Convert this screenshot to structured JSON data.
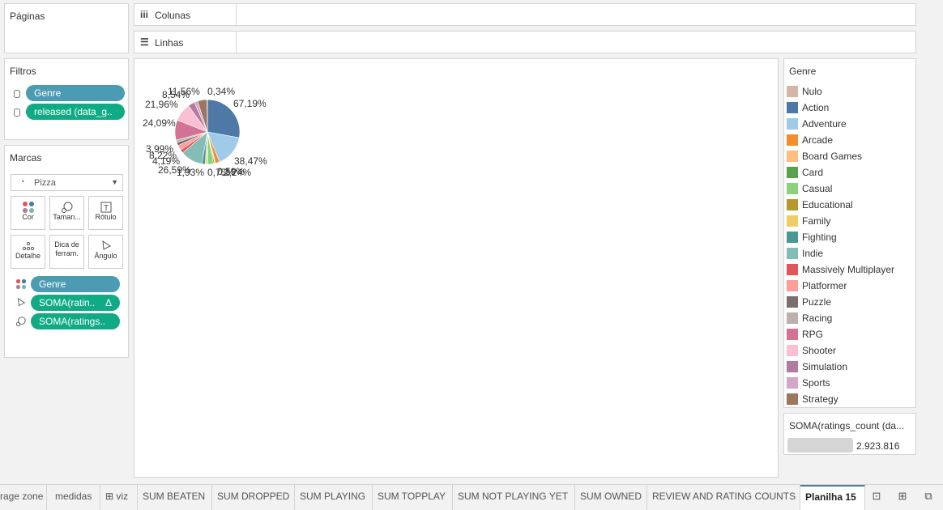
{
  "pages_panel": {
    "title": "Páginas"
  },
  "filters_panel": {
    "title": "Filtros",
    "pills": [
      "Genre",
      "released (data_g.."
    ]
  },
  "marks_panel": {
    "title": "Marcas",
    "mark_type": "Pizza",
    "buttons": [
      {
        "label": "Cor",
        "icon": "color-icon"
      },
      {
        "label": "Taman...",
        "icon": "size-icon"
      },
      {
        "label": "Rótulo",
        "icon": "label-icon"
      },
      {
        "label": "Detalhe",
        "icon": "detail-icon"
      },
      {
        "label": "Dica de ferram.",
        "icon": "tooltip-icon"
      },
      {
        "label": "Ângulo",
        "icon": "angle-icon"
      }
    ],
    "encodings": [
      {
        "label": "Genre",
        "icon": "color-icon",
        "color": "blue"
      },
      {
        "label": "SOMA(ratin..",
        "icon": "angle-icon",
        "color": "green",
        "delta": "Δ"
      },
      {
        "label": "SOMA(ratings..",
        "icon": "size-icon",
        "color": "green"
      }
    ]
  },
  "shelves": {
    "columns": {
      "label": "Colunas",
      "icon": "iii"
    },
    "rows": {
      "label": "Linhas",
      "icon": "☰"
    }
  },
  "chart_data": {
    "type": "pie",
    "slices": [
      {
        "genre": "Action",
        "value": 67.19,
        "color": "#4e79a7"
      },
      {
        "genre": "Adventure",
        "value": 38.47,
        "color": "#a0cbe8"
      },
      {
        "genre": "Arcade",
        "value": 5.0,
        "color": "#f28e2b"
      },
      {
        "genre": "Board Games",
        "value": 1.0,
        "color": "#ffbe7d"
      },
      {
        "genre": "Card",
        "value": 1.5,
        "color": "#59a14f"
      },
      {
        "genre": "Casual",
        "value": 7.0,
        "color": "#8cd17d"
      },
      {
        "genre": "Educational",
        "value": 1.0,
        "color": "#b6992d"
      },
      {
        "genre": "Family",
        "value": 2.0,
        "color": "#f1ce63"
      },
      {
        "genre": "Fighting",
        "value": 4.0,
        "color": "#499894"
      },
      {
        "genre": "Indie",
        "value": 26.59,
        "color": "#86bcb6"
      },
      {
        "genre": "Massively Multiplayer",
        "value": 4.19,
        "color": "#e15759"
      },
      {
        "genre": "Platformer",
        "value": 6.0,
        "color": "#ff9d9a"
      },
      {
        "genre": "Puzzle",
        "value": 3.99,
        "color": "#79706e"
      },
      {
        "genre": "Racing",
        "value": 3.0,
        "color": "#bab0ac"
      },
      {
        "genre": "RPG",
        "value": 24.09,
        "color": "#d37295"
      },
      {
        "genre": "Shooter",
        "value": 21.96,
        "color": "#fabfd2"
      },
      {
        "genre": "Simulation",
        "value": 8.0,
        "color": "#b07aa1"
      },
      {
        "genre": "Sports",
        "value": 4.0,
        "color": "#d4a6c8"
      },
      {
        "genre": "Strategy",
        "value": 11.56,
        "color": "#9d7660"
      },
      {
        "genre": "Nulo",
        "value": 0.34,
        "color": "#d7b5a6"
      }
    ],
    "labels": [
      "67,19%",
      "38,47%",
      "26,59%",
      "24,09%",
      "21,96%",
      "11,56%",
      "0,34%",
      "8,54%",
      "4,19%",
      "3,99%",
      "8,22%",
      "1,93%",
      "0,75%",
      "0,59%",
      "2,24%"
    ]
  },
  "legend": {
    "title": "Genre",
    "items": [
      {
        "label": "Nulo",
        "color": "#d7b5a6"
      },
      {
        "label": "Action",
        "color": "#4e79a7"
      },
      {
        "label": "Adventure",
        "color": "#a0cbe8"
      },
      {
        "label": "Arcade",
        "color": "#f28e2b"
      },
      {
        "label": "Board Games",
        "color": "#ffbe7d"
      },
      {
        "label": "Card",
        "color": "#59a14f"
      },
      {
        "label": "Casual",
        "color": "#8cd17d"
      },
      {
        "label": "Educational",
        "color": "#b6992d"
      },
      {
        "label": "Family",
        "color": "#f1ce63"
      },
      {
        "label": "Fighting",
        "color": "#499894"
      },
      {
        "label": "Indie",
        "color": "#86bcb6"
      },
      {
        "label": "Massively Multiplayer",
        "color": "#e15759"
      },
      {
        "label": "Platformer",
        "color": "#ff9d9a"
      },
      {
        "label": "Puzzle",
        "color": "#79706e"
      },
      {
        "label": "Racing",
        "color": "#bab0ac"
      },
      {
        "label": "RPG",
        "color": "#d37295"
      },
      {
        "label": "Shooter",
        "color": "#fabfd2"
      },
      {
        "label": "Simulation",
        "color": "#b07aa1"
      },
      {
        "label": "Sports",
        "color": "#d4a6c8"
      },
      {
        "label": "Strategy",
        "color": "#9d7660"
      }
    ]
  },
  "size_legend": {
    "title": "SOMA(ratings_count (da...",
    "value": "2.923.816"
  },
  "tabs": [
    "rage zone",
    "medidas",
    "viz",
    "SUM BEATEN",
    "SUM DROPPED",
    "SUM PLAYING",
    "SUM TOPPLAY",
    "SUM NOT PLAYING YET",
    "SUM OWNED",
    "REVIEW AND RATING COUNTS",
    "Planilha 15"
  ]
}
